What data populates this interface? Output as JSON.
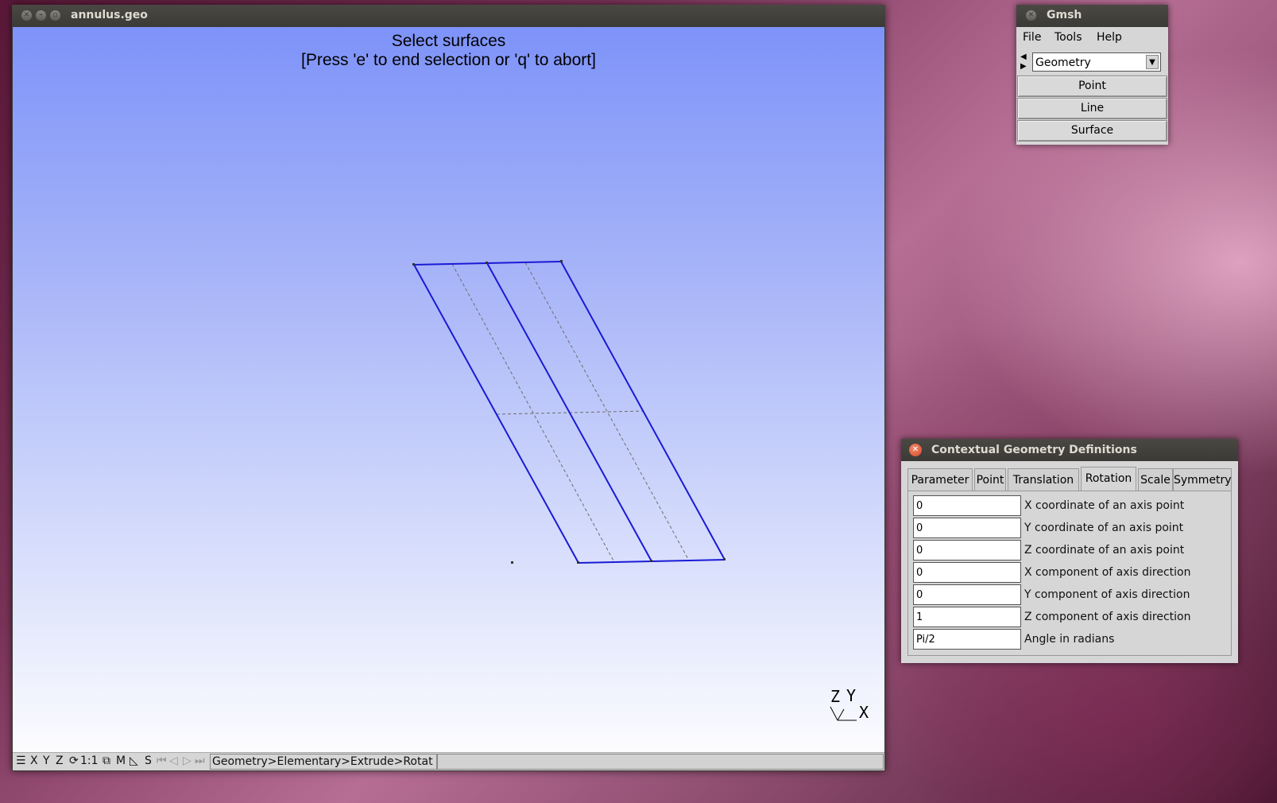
{
  "main_window": {
    "title": "annulus.geo",
    "overlay_line1": "Select surfaces",
    "overlay_line2": "[Press 'e' to end selection or 'q' to abort]",
    "axes": {
      "z": "Z",
      "y": "Y",
      "x": "X"
    },
    "statusbar": {
      "menu_icon": "menu-icon",
      "x": "X",
      "y": "Y",
      "z": "Z",
      "rotate_icon": "rotate-icon",
      "scale": "1:1",
      "ortho_icon": "cube-icon",
      "m": "M",
      "measure_icon": "ruler-icon",
      "s": "S",
      "message": "Geometry>Elementary>Extrude>Rotat"
    },
    "colors": {
      "edges": "#1a1ad6",
      "dashed": "#7a7a7a"
    }
  },
  "gmsh_window": {
    "title": "Gmsh",
    "menu": [
      "File",
      "Tools",
      "Help"
    ],
    "module_select": "Geometry",
    "buttons": [
      "Point",
      "Line",
      "Surface"
    ]
  },
  "ctx_dialog": {
    "title": "Contextual Geometry Definitions",
    "tabs": [
      "Parameter",
      "Point",
      "Translation",
      "Rotation",
      "Scale",
      "Symmetry"
    ],
    "active_tab": "Rotation",
    "fields": [
      {
        "value": "0",
        "label": "X coordinate of an axis point"
      },
      {
        "value": "0",
        "label": "Y coordinate of an axis point"
      },
      {
        "value": "0",
        "label": "Z coordinate of an axis point"
      },
      {
        "value": "0",
        "label": "X component of axis direction"
      },
      {
        "value": "0",
        "label": "Y component of axis direction"
      },
      {
        "value": "1",
        "label": "Z component of axis direction"
      },
      {
        "value": "Pi/2",
        "label": "Angle in radians"
      }
    ]
  }
}
